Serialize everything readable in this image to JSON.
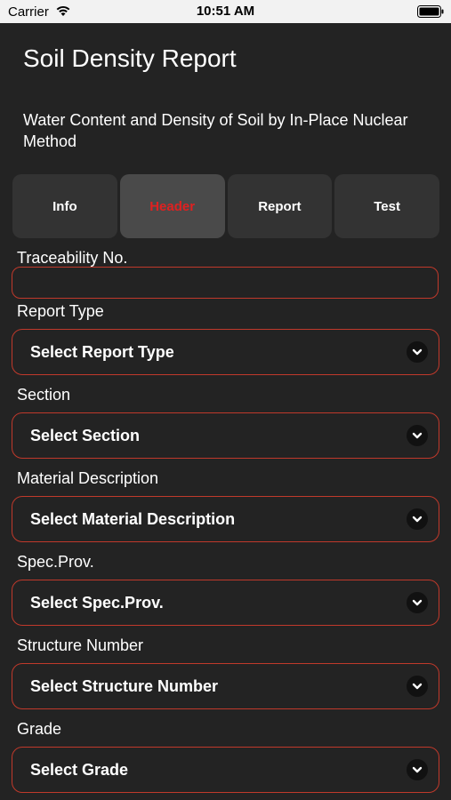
{
  "status_bar": {
    "carrier": "Carrier",
    "time": "10:51 AM"
  },
  "header": {
    "title": "Soil Density Report",
    "subtitle": "Water Content and Density of Soil by In-Place Nuclear Method"
  },
  "tabs": [
    {
      "label": "Info"
    },
    {
      "label": "Header",
      "active": true
    },
    {
      "label": "Report"
    },
    {
      "label": "Test"
    }
  ],
  "form": {
    "traceability": {
      "label": "Traceability No.",
      "value": ""
    },
    "report_type": {
      "label": "Report Type",
      "value": "Select Report Type"
    },
    "section": {
      "label": "Section",
      "value": "Select Section"
    },
    "material": {
      "label": "Material Description",
      "value": "Select Material Description"
    },
    "spec": {
      "label": "Spec.Prov.",
      "value": "Select Spec.Prov."
    },
    "structure": {
      "label": "Structure Number",
      "value": "Select Structure Number"
    },
    "grade": {
      "label": "Grade",
      "value": "Select Grade"
    }
  },
  "colors": {
    "accent": "#e02020",
    "border": "#c0392b",
    "background": "#232323",
    "tab": "#333333"
  },
  "icons": [
    "wifi-icon",
    "battery-icon",
    "chevron-down-icon"
  ]
}
